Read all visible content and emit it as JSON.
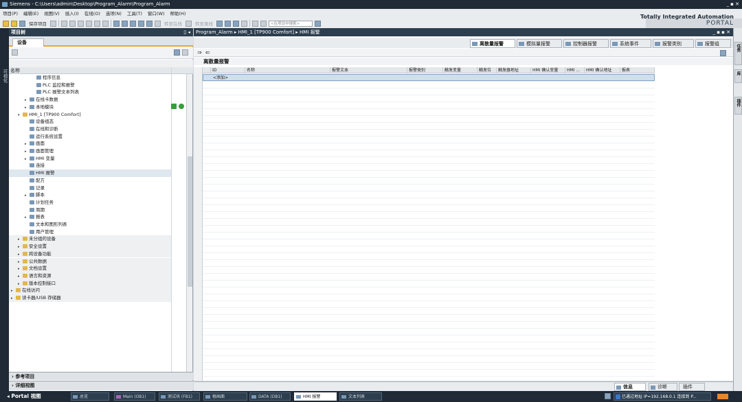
{
  "title_bar": {
    "text": "Siemens - C:\\Users\\admin\\Desktop\\Program_Alarm\\Program_Alarm",
    "controls": "_ ▪ ✕"
  },
  "menu": [
    "项目(P)",
    "编辑(E)",
    "视图(V)",
    "插入(I)",
    "在线(O)",
    "选项(N)",
    "工具(T)",
    "窗口(W)",
    "帮助(H)"
  ],
  "brand": {
    "line1": "Totally Integrated Automation",
    "line2": "PORTAL"
  },
  "toolbar": {
    "save_project": "保存项目",
    "go_online": "转至在线",
    "go_offline": "转至离线",
    "search_placeholder": "<在项目中搜索>"
  },
  "left_strip": {
    "label": "可视化"
  },
  "tree_panel": {
    "title": "项目树",
    "tab": "设备",
    "col_name": "名称",
    "items": [
      {
        "label": "程序信息",
        "indent": 3,
        "arrow": ""
      },
      {
        "label": "PLC 监控和报警",
        "indent": 3,
        "arrow": ""
      },
      {
        "label": "PLC 报警文本列表",
        "indent": 3,
        "arrow": ""
      },
      {
        "label": "在线卡数据",
        "indent": 2,
        "arrow": "▸"
      },
      {
        "label": "本地模块",
        "indent": 2,
        "arrow": "▸"
      },
      {
        "label": "HMI_1 [TP900 Comfort]",
        "indent": 1,
        "arrow": "▾"
      },
      {
        "label": "设备组态",
        "indent": 2,
        "arrow": ""
      },
      {
        "label": "在线和诊断",
        "indent": 2,
        "arrow": ""
      },
      {
        "label": "运行系统设置",
        "indent": 2,
        "arrow": ""
      },
      {
        "label": "画面",
        "indent": 2,
        "arrow": "▸"
      },
      {
        "label": "画面管理",
        "indent": 2,
        "arrow": "▸"
      },
      {
        "label": "HMI 变量",
        "indent": 2,
        "arrow": "▸"
      },
      {
        "label": "连接",
        "indent": 2,
        "arrow": ""
      },
      {
        "label": "HMI 报警",
        "indent": 2,
        "arrow": ""
      },
      {
        "label": "配方",
        "indent": 2,
        "arrow": ""
      },
      {
        "label": "记录",
        "indent": 2,
        "arrow": ""
      },
      {
        "label": "脚本",
        "indent": 2,
        "arrow": "▸"
      },
      {
        "label": "计划任务",
        "indent": 2,
        "arrow": ""
      },
      {
        "label": "周期",
        "indent": 2,
        "arrow": ""
      },
      {
        "label": "报表",
        "indent": 2,
        "arrow": "▸"
      },
      {
        "label": "文本和图形列表",
        "indent": 2,
        "arrow": ""
      },
      {
        "label": "用户管理",
        "indent": 2,
        "arrow": ""
      },
      {
        "label": "未分组的设备",
        "indent": 1,
        "arrow": "▸"
      },
      {
        "label": "安全设置",
        "indent": 1,
        "arrow": "▸"
      },
      {
        "label": "跨设备功能",
        "indent": 1,
        "arrow": "▸"
      },
      {
        "label": "公共数据",
        "indent": 1,
        "arrow": "▸"
      },
      {
        "label": "文档设置",
        "indent": 1,
        "arrow": "▸"
      },
      {
        "label": "语言和资源",
        "indent": 1,
        "arrow": "▸"
      },
      {
        "label": "版本控制接口",
        "indent": 1,
        "arrow": "▸"
      },
      {
        "label": "在线访问",
        "indent": 0,
        "arrow": "▸"
      },
      {
        "label": "读卡器/USB 存储器",
        "indent": 0,
        "arrow": "▸"
      }
    ],
    "ref_projects": "参考项目",
    "detail_view": "详细视图"
  },
  "editor": {
    "breadcrumb": "Program_Alarm ▸ HMI_1 [TP900 Comfort] ▸ HMI 报警",
    "tabs": [
      "离散量报警",
      "模拟量报警",
      "控制器报警",
      "系统事件",
      "报警类别",
      "报警组"
    ],
    "table_title": "离散量报警",
    "columns": [
      "ID",
      "名称",
      "报警文本",
      "报警类别",
      "触发变量",
      "触发位",
      "触发器地址",
      "HMI 确认变量",
      "HMI ...",
      "HMI 确认地址",
      "报表"
    ],
    "add_row": "<添加>"
  },
  "right_strip": {
    "tabs": [
      "任务",
      "库",
      "插件"
    ]
  },
  "inspector": {
    "info": "信息",
    "diagnostics": "诊断",
    "plugins": "插件"
  },
  "status_bar": {
    "portal_view": "Portal 视图",
    "tasks": [
      "总览",
      "Main (OB1)",
      "测试块 (FB1)",
      "根画面",
      "DATA (DB1)",
      "HMI 报警",
      "文本列表"
    ],
    "message": "已通过地址 IP=192.168.0.1 连接到 P..."
  }
}
